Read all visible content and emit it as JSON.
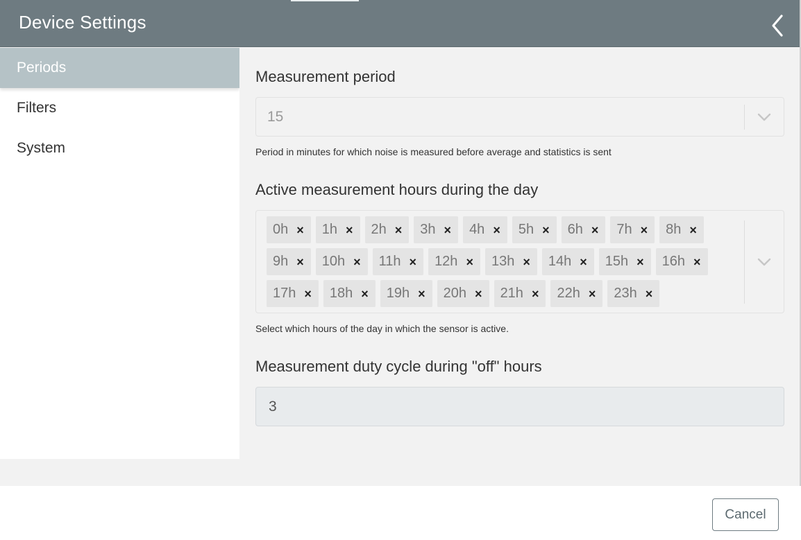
{
  "window": {
    "title": "Device Settings",
    "back_icon": "chevron-left-icon"
  },
  "sidebar": {
    "items": [
      {
        "label": "Periods",
        "active": true
      },
      {
        "label": "Filters",
        "active": false
      },
      {
        "label": "System",
        "active": false
      }
    ]
  },
  "measurement_period": {
    "label": "Measurement period",
    "value": "15",
    "help": "Period in minutes for which noise is measured before average and statistics is sent"
  },
  "active_hours": {
    "label": "Active measurement hours during the day",
    "help": "Select which hours of the day in which the sensor is active.",
    "rows": [
      [
        "0h",
        "1h",
        "2h",
        "3h",
        "4h",
        "5h",
        "6h",
        "7h",
        "8h"
      ],
      [
        "9h",
        "10h",
        "11h",
        "12h",
        "13h",
        "14h",
        "15h",
        "16h"
      ],
      [
        "17h",
        "18h",
        "19h",
        "20h",
        "21h",
        "22h",
        "23h"
      ]
    ],
    "remove_glyph": "×"
  },
  "duty_cycle": {
    "label": "Measurement duty cycle during \"off\" hours",
    "value": "3"
  },
  "footer": {
    "cancel_label": "Cancel"
  },
  "colors": {
    "title_bar": "#6e7b81",
    "sidebar_active": "#b5c2c6",
    "content_bg": "#f2f2f2",
    "tag_bg": "#e4e4e4"
  }
}
